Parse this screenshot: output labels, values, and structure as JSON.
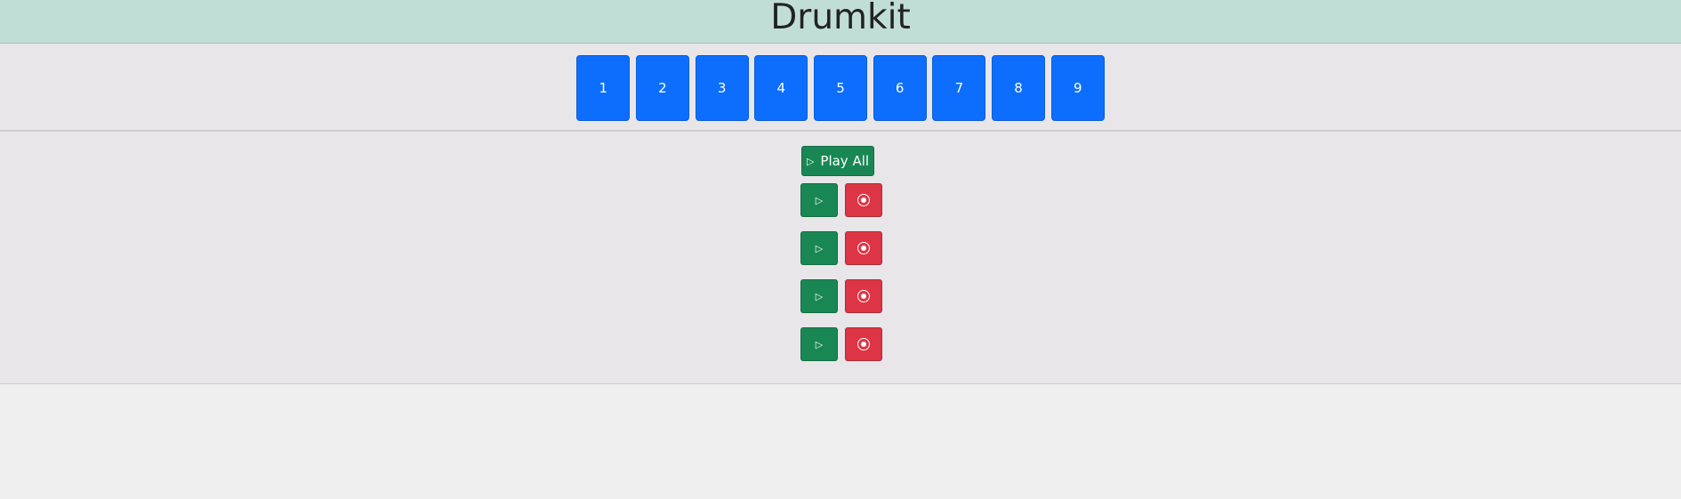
{
  "header": {
    "title": "Drumkit"
  },
  "pads": [
    {
      "label": "1"
    },
    {
      "label": "2"
    },
    {
      "label": "3"
    },
    {
      "label": "4"
    },
    {
      "label": "5"
    },
    {
      "label": "6"
    },
    {
      "label": "7"
    },
    {
      "label": "8"
    },
    {
      "label": "9"
    }
  ],
  "controls": {
    "play_all_icon": "▷",
    "play_all_label": "Play All"
  },
  "tracks": [
    {
      "play_icon": "▷",
      "record_icon": "record-icon"
    },
    {
      "play_icon": "▷",
      "record_icon": "record-icon"
    },
    {
      "play_icon": "▷",
      "record_icon": "record-icon"
    },
    {
      "play_icon": "▷",
      "record_icon": "record-icon"
    }
  ],
  "colors": {
    "header_bg": "#c0ddd6",
    "pad": "#0d6efd",
    "play": "#198754",
    "record": "#dc3545"
  }
}
